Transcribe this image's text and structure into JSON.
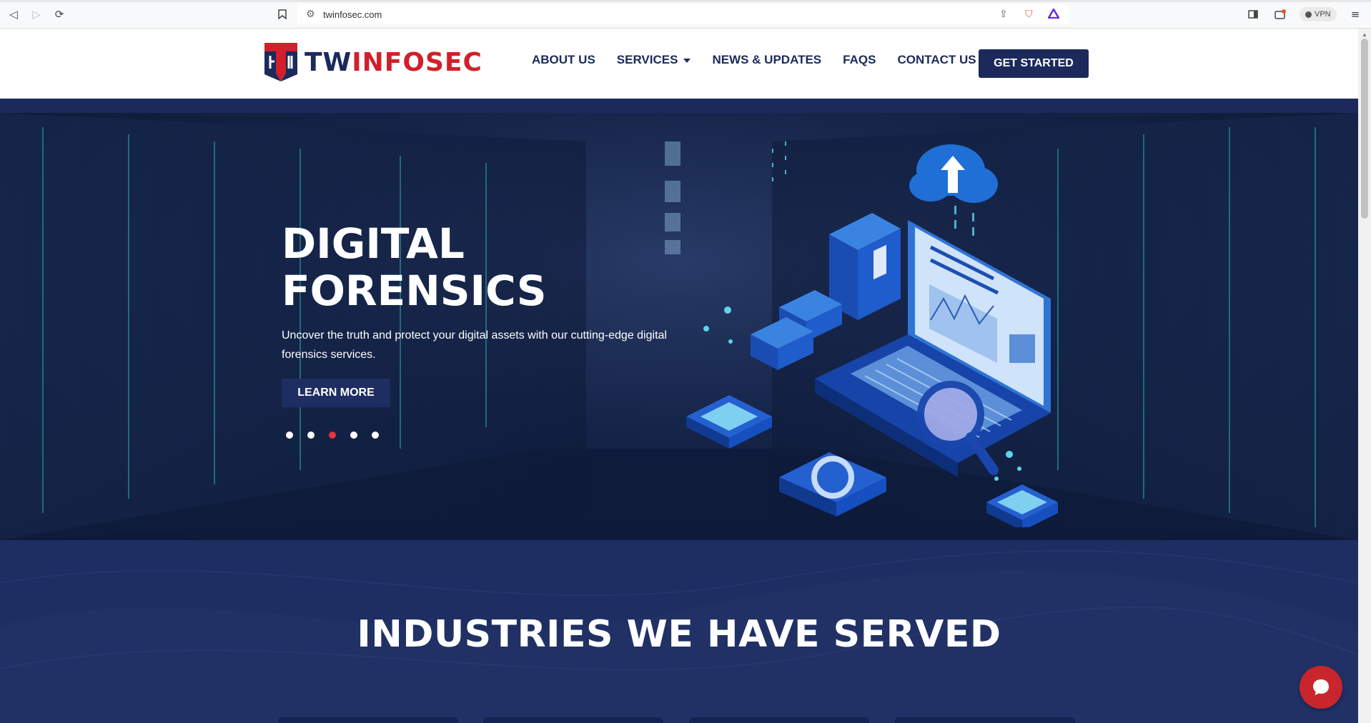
{
  "browser": {
    "url": "twinfosec.com",
    "vpn_label": "VPN"
  },
  "header": {
    "logo_prefix": "TW",
    "logo_suffix": "INFOSEC",
    "nav": [
      {
        "label": "ABOUT US"
      },
      {
        "label": "SERVICES"
      },
      {
        "label": "NEWS & UPDATES"
      },
      {
        "label": "FAQS"
      },
      {
        "label": "CONTACT US"
      }
    ],
    "cta_label": "GET STARTED"
  },
  "hero": {
    "title_line1": "DIGITAL",
    "title_line2": "FORENSICS",
    "subtitle": "Uncover the truth and protect your digital assets with our cutting-edge digital forensics services.",
    "button_label": "LEARN MORE",
    "slide_count": 5,
    "active_slide": 3
  },
  "industries": {
    "title": "INDUSTRIES WE HAVE SERVED"
  },
  "colors": {
    "brand_navy": "#1b2a5a",
    "brand_red": "#d21f2b",
    "slider_active": "#e3343c"
  },
  "icons": [
    "back-icon",
    "forward-icon",
    "reload-icon",
    "bookmark-icon",
    "site-settings-icon",
    "share-icon",
    "brave-shields-icon",
    "rewards-icon",
    "sidebar-icon",
    "wallet-icon",
    "menu-icon",
    "chat-icon"
  ]
}
